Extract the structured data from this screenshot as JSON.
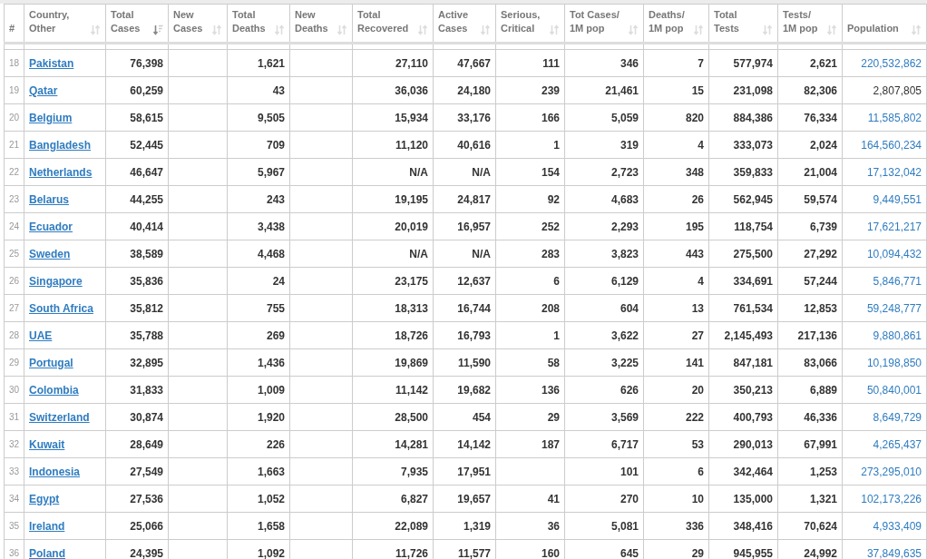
{
  "columns": [
    {
      "label": "#",
      "sortable": false
    },
    {
      "label": "Country,\nOther",
      "sortable": true,
      "sorted": false
    },
    {
      "label": "Total\nCases",
      "sortable": true,
      "sorted": true
    },
    {
      "label": "New\nCases",
      "sortable": true,
      "sorted": false
    },
    {
      "label": "Total\nDeaths",
      "sortable": true,
      "sorted": false
    },
    {
      "label": "New\nDeaths",
      "sortable": true,
      "sorted": false
    },
    {
      "label": "Total\nRecovered",
      "sortable": true,
      "sorted": false
    },
    {
      "label": "Active\nCases",
      "sortable": true,
      "sorted": false
    },
    {
      "label": "Serious,\nCritical",
      "sortable": true,
      "sorted": false
    },
    {
      "label": "Tot Cases/\n1M pop",
      "sortable": true,
      "sorted": false
    },
    {
      "label": "Deaths/\n1M pop",
      "sortable": true,
      "sorted": false
    },
    {
      "label": "Total\nTests",
      "sortable": true,
      "sorted": false
    },
    {
      "label": "Tests/\n1M pop",
      "sortable": true,
      "sorted": false
    },
    {
      "label": "Population",
      "sortable": true,
      "sorted": false
    }
  ],
  "rows": [
    {
      "num": "18",
      "country": "Pakistan",
      "total_cases": "76,398",
      "total_deaths": "1,621",
      "total_recovered": "27,110",
      "active_cases": "47,667",
      "serious_critical": "111",
      "tot_cases_per_1m": "346",
      "deaths_per_1m": "7",
      "total_tests": "577,974",
      "tests_per_1m": "2,621",
      "population": "220,532,862",
      "population_link": true
    },
    {
      "num": "19",
      "country": "Qatar",
      "total_cases": "60,259",
      "total_deaths": "43",
      "total_recovered": "36,036",
      "active_cases": "24,180",
      "serious_critical": "239",
      "tot_cases_per_1m": "21,461",
      "deaths_per_1m": "15",
      "total_tests": "231,098",
      "tests_per_1m": "82,306",
      "population": "2,807,805",
      "population_link": false
    },
    {
      "num": "20",
      "country": "Belgium",
      "total_cases": "58,615",
      "total_deaths": "9,505",
      "total_recovered": "15,934",
      "active_cases": "33,176",
      "serious_critical": "166",
      "tot_cases_per_1m": "5,059",
      "deaths_per_1m": "820",
      "total_tests": "884,386",
      "tests_per_1m": "76,334",
      "population": "11,585,802",
      "population_link": true
    },
    {
      "num": "21",
      "country": "Bangladesh",
      "total_cases": "52,445",
      "total_deaths": "709",
      "total_recovered": "11,120",
      "active_cases": "40,616",
      "serious_critical": "1",
      "tot_cases_per_1m": "319",
      "deaths_per_1m": "4",
      "total_tests": "333,073",
      "tests_per_1m": "2,024",
      "population": "164,560,234",
      "population_link": true
    },
    {
      "num": "22",
      "country": "Netherlands",
      "total_cases": "46,647",
      "total_deaths": "5,967",
      "total_recovered": "N/A",
      "active_cases": "N/A",
      "serious_critical": "154",
      "tot_cases_per_1m": "2,723",
      "deaths_per_1m": "348",
      "total_tests": "359,833",
      "tests_per_1m": "21,004",
      "population": "17,132,042",
      "population_link": true
    },
    {
      "num": "23",
      "country": "Belarus",
      "total_cases": "44,255",
      "total_deaths": "243",
      "total_recovered": "19,195",
      "active_cases": "24,817",
      "serious_critical": "92",
      "tot_cases_per_1m": "4,683",
      "deaths_per_1m": "26",
      "total_tests": "562,945",
      "tests_per_1m": "59,574",
      "population": "9,449,551",
      "population_link": true
    },
    {
      "num": "24",
      "country": "Ecuador",
      "total_cases": "40,414",
      "total_deaths": "3,438",
      "total_recovered": "20,019",
      "active_cases": "16,957",
      "serious_critical": "252",
      "tot_cases_per_1m": "2,293",
      "deaths_per_1m": "195",
      "total_tests": "118,754",
      "tests_per_1m": "6,739",
      "population": "17,621,217",
      "population_link": true
    },
    {
      "num": "25",
      "country": "Sweden",
      "total_cases": "38,589",
      "total_deaths": "4,468",
      "total_recovered": "N/A",
      "active_cases": "N/A",
      "serious_critical": "283",
      "tot_cases_per_1m": "3,823",
      "deaths_per_1m": "443",
      "total_tests": "275,500",
      "tests_per_1m": "27,292",
      "population": "10,094,432",
      "population_link": true
    },
    {
      "num": "26",
      "country": "Singapore",
      "total_cases": "35,836",
      "total_deaths": "24",
      "total_recovered": "23,175",
      "active_cases": "12,637",
      "serious_critical": "6",
      "tot_cases_per_1m": "6,129",
      "deaths_per_1m": "4",
      "total_tests": "334,691",
      "tests_per_1m": "57,244",
      "population": "5,846,771",
      "population_link": true
    },
    {
      "num": "27",
      "country": "South Africa",
      "total_cases": "35,812",
      "total_deaths": "755",
      "total_recovered": "18,313",
      "active_cases": "16,744",
      "serious_critical": "208",
      "tot_cases_per_1m": "604",
      "deaths_per_1m": "13",
      "total_tests": "761,534",
      "tests_per_1m": "12,853",
      "population": "59,248,777",
      "population_link": true
    },
    {
      "num": "28",
      "country": "UAE",
      "total_cases": "35,788",
      "total_deaths": "269",
      "total_recovered": "18,726",
      "active_cases": "16,793",
      "serious_critical": "1",
      "tot_cases_per_1m": "3,622",
      "deaths_per_1m": "27",
      "total_tests": "2,145,493",
      "tests_per_1m": "217,136",
      "population": "9,880,861",
      "population_link": true
    },
    {
      "num": "29",
      "country": "Portugal",
      "total_cases": "32,895",
      "total_deaths": "1,436",
      "total_recovered": "19,869",
      "active_cases": "11,590",
      "serious_critical": "58",
      "tot_cases_per_1m": "3,225",
      "deaths_per_1m": "141",
      "total_tests": "847,181",
      "tests_per_1m": "83,066",
      "population": "10,198,850",
      "population_link": true
    },
    {
      "num": "30",
      "country": "Colombia",
      "total_cases": "31,833",
      "total_deaths": "1,009",
      "total_recovered": "11,142",
      "active_cases": "19,682",
      "serious_critical": "136",
      "tot_cases_per_1m": "626",
      "deaths_per_1m": "20",
      "total_tests": "350,213",
      "tests_per_1m": "6,889",
      "population": "50,840,001",
      "population_link": true
    },
    {
      "num": "31",
      "country": "Switzerland",
      "total_cases": "30,874",
      "total_deaths": "1,920",
      "total_recovered": "28,500",
      "active_cases": "454",
      "serious_critical": "29",
      "tot_cases_per_1m": "3,569",
      "deaths_per_1m": "222",
      "total_tests": "400,793",
      "tests_per_1m": "46,336",
      "population": "8,649,729",
      "population_link": true
    },
    {
      "num": "32",
      "country": "Kuwait",
      "total_cases": "28,649",
      "total_deaths": "226",
      "total_recovered": "14,281",
      "active_cases": "14,142",
      "serious_critical": "187",
      "tot_cases_per_1m": "6,717",
      "deaths_per_1m": "53",
      "total_tests": "290,013",
      "tests_per_1m": "67,991",
      "population": "4,265,437",
      "population_link": true
    },
    {
      "num": "33",
      "country": "Indonesia",
      "total_cases": "27,549",
      "total_deaths": "1,663",
      "total_recovered": "7,935",
      "active_cases": "17,951",
      "tot_cases_per_1m": "101",
      "deaths_per_1m": "6",
      "total_tests": "342,464",
      "tests_per_1m": "1,253",
      "population": "273,295,010",
      "population_link": true
    },
    {
      "num": "34",
      "country": "Egypt",
      "total_cases": "27,536",
      "total_deaths": "1,052",
      "total_recovered": "6,827",
      "active_cases": "19,657",
      "serious_critical": "41",
      "tot_cases_per_1m": "270",
      "deaths_per_1m": "10",
      "total_tests": "135,000",
      "tests_per_1m": "1,321",
      "population": "102,173,226",
      "population_link": true
    },
    {
      "num": "35",
      "country": "Ireland",
      "total_cases": "25,066",
      "total_deaths": "1,658",
      "total_recovered": "22,089",
      "active_cases": "1,319",
      "serious_critical": "36",
      "tot_cases_per_1m": "5,081",
      "deaths_per_1m": "336",
      "total_tests": "348,416",
      "tests_per_1m": "70,624",
      "population": "4,933,409",
      "population_link": true
    },
    {
      "num": "36",
      "country": "Poland",
      "total_cases": "24,395",
      "total_deaths": "1,092",
      "total_recovered": "11,726",
      "active_cases": "11,577",
      "serious_critical": "160",
      "tot_cases_per_1m": "645",
      "deaths_per_1m": "29",
      "total_tests": "945,955",
      "tests_per_1m": "24,992",
      "population": "37,849,635",
      "population_link": true
    }
  ]
}
